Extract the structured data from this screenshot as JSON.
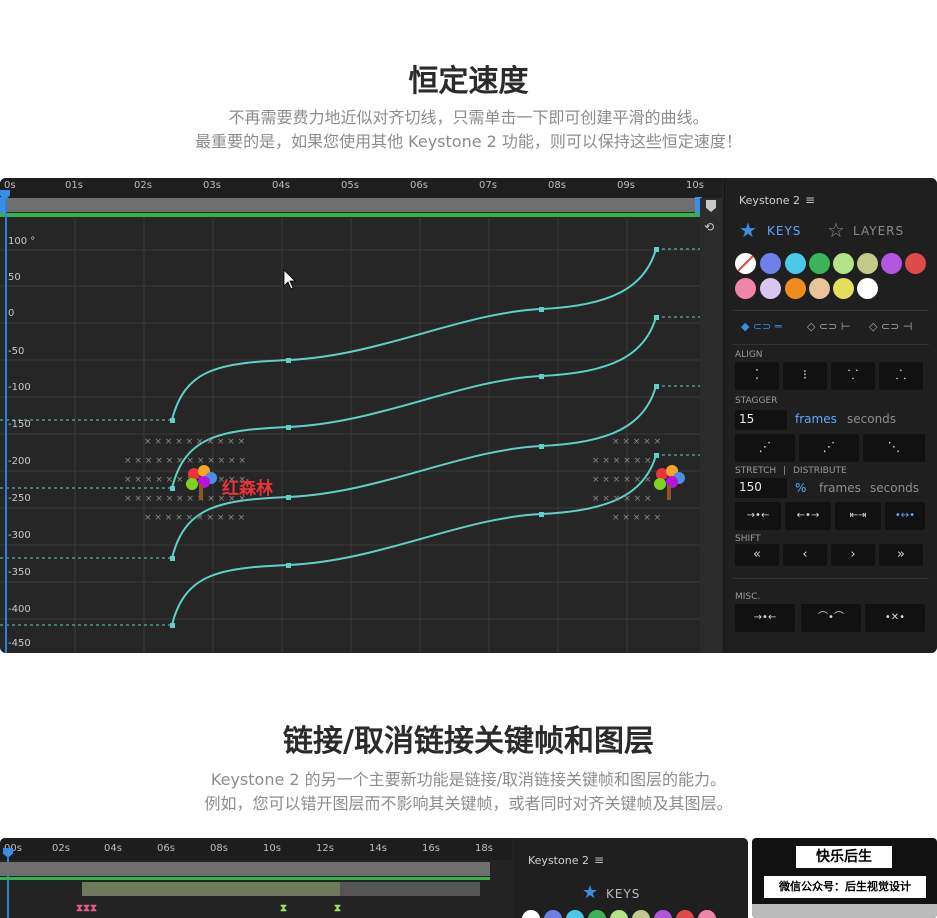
{
  "section1": {
    "title": "恒定速度",
    "desc_line1": "不再需要费力地近似对齐切线，只需单击一下即可创建平滑的曲线。",
    "desc_line2": "最重要的是，如果您使用其他 Keystone 2 功能，则可以保持这些恒定速度！"
  },
  "graph": {
    "ruler": [
      "0s",
      "01s",
      "02s",
      "03s",
      "04s",
      "05s",
      "06s",
      "07s",
      "08s",
      "09s",
      "10s"
    ],
    "yaxis": [
      "100 °",
      "50",
      "0",
      "-50",
      "-100",
      "-150",
      "-200",
      "-250",
      "-300",
      "-350",
      "-400",
      "-450"
    ],
    "curve_color": "#5fd0c8"
  },
  "panel": {
    "title": "Keystone 2",
    "menu_icon": "hamburger-icon",
    "tab_keys": "KEYS",
    "tab_layers": "LAYERS",
    "swatches": [
      "#ffffff",
      "#6f7fe8",
      "#4cc9e8",
      "#3bb35a",
      "#b4e38a",
      "#c2c98a",
      "#b455e0",
      "#e04a4a",
      "#ef86a8",
      "#d9c6ee",
      "#ef8c1e",
      "#e8c39a",
      "#e3df5a",
      "#ffffff"
    ],
    "align_label": "ALIGN",
    "stagger_label": "STAGGER",
    "stagger_value": "15",
    "frames": "frames",
    "seconds": "seconds",
    "stretch_label": "STRETCH",
    "sep": "|",
    "distribute_label": "DISTRIBUTE",
    "stretch_value": "150",
    "percent": "%",
    "shift_label": "SHIFT",
    "shift_buttons": [
      "«",
      "‹",
      "›",
      "»"
    ],
    "misc_label": "MISC."
  },
  "watermark": {
    "text": "红森林"
  },
  "section2": {
    "title": "链接/取消链接关键帧和图层",
    "desc_line1": "Keystone 2 的另一个主要新功能是链接/取消链接关键帧和图层的能力。",
    "desc_line2": "例如，您可以错开图层而不影响其关键帧，或者同时对齐关键帧及其图层。"
  },
  "window2": {
    "ruler": [
      "00s",
      "02s",
      "04s",
      "06s",
      "08s",
      "10s",
      "12s",
      "14s",
      "16s",
      "18s"
    ],
    "panel_title": "Keystone 2",
    "tab_keys": "KEYS"
  },
  "qr": {
    "top": "快乐后生",
    "bottom": "微信公众号：后生视觉设计"
  }
}
